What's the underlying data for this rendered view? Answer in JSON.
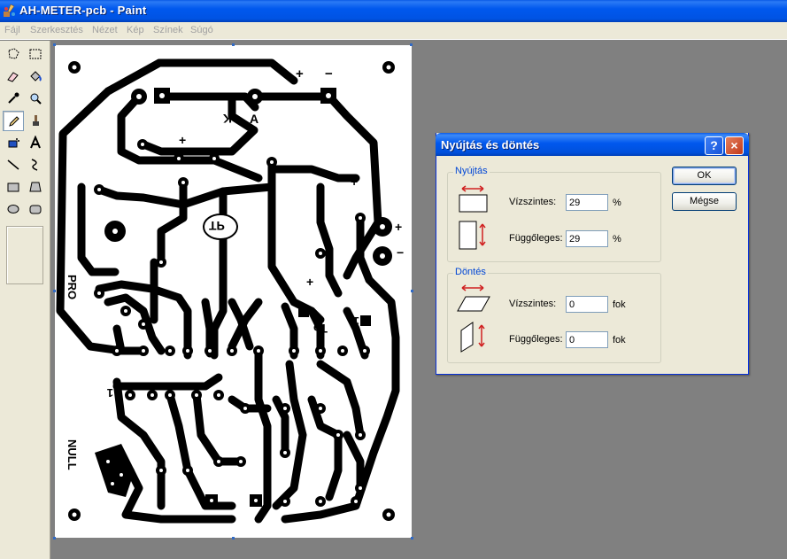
{
  "window": {
    "title": "AH-METER-pcb - Paint"
  },
  "menu": [
    "Fájl",
    "Szerkesztés",
    "Nézet",
    "Kép",
    "Színek",
    "Súgó"
  ],
  "toolbox": {
    "tools": [
      "free-form-select",
      "rectangle-select",
      "eraser",
      "fill",
      "color-picker",
      "magnifier",
      "pencil",
      "brush",
      "airbrush",
      "text",
      "line",
      "curve",
      "rectangle",
      "polygon",
      "ellipse",
      "rounded-rectangle"
    ],
    "active_tool": "pencil"
  },
  "canvas": {
    "labels": {
      "plus_top": "+",
      "minus_top": "−",
      "k": "K",
      "a": "A",
      "plus_left": "+",
      "plus_right": "+",
      "plus_side": "+",
      "minus_side": "−",
      "tp": "TP",
      "pro": "PRO",
      "plus_mid": "+",
      "one_right": "1",
      "to": "To",
      "one_left": "1",
      "null": "NULL"
    }
  },
  "dialog": {
    "title": "Nyújtás és döntés",
    "help": "?",
    "close": "×",
    "stretch": {
      "label": "Nyújtás",
      "horizontal_label": "Vízszintes:",
      "horizontal_value": "29",
      "horizontal_unit": "%",
      "vertical_label": "Függőleges:",
      "vertical_value": "29",
      "vertical_unit": "%"
    },
    "skew": {
      "label": "Döntés",
      "horizontal_label": "Vízszintes:",
      "horizontal_value": "0",
      "horizontal_unit": "fok",
      "vertical_label": "Függőleges:",
      "vertical_value": "0",
      "vertical_unit": "fok"
    },
    "ok_label": "OK",
    "cancel_label": "Mégse"
  }
}
